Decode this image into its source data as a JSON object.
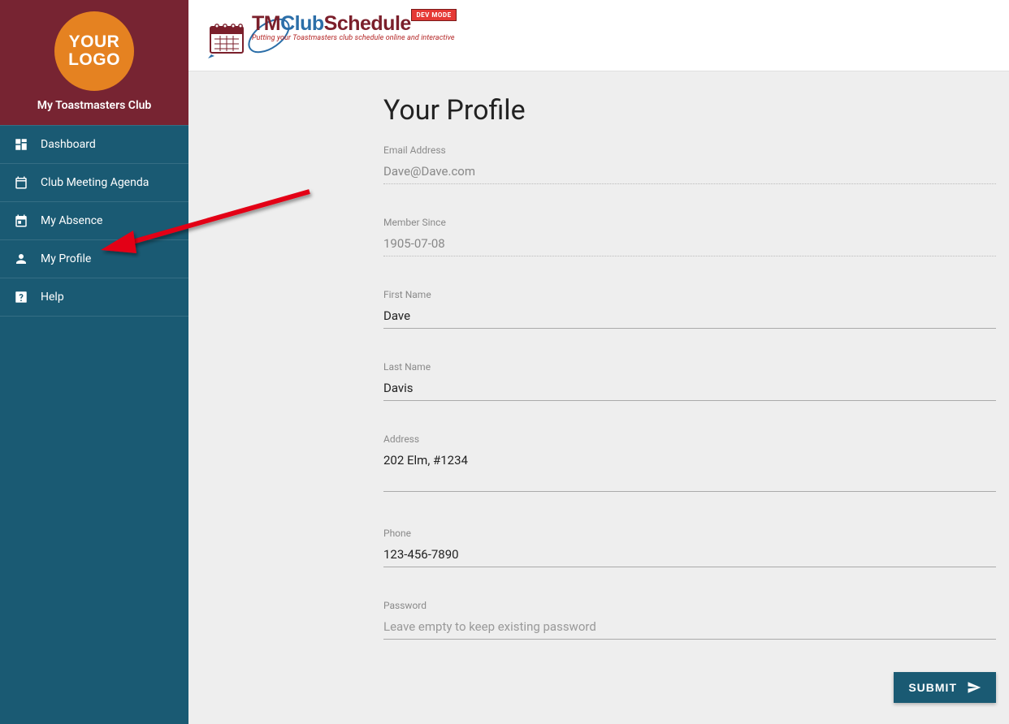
{
  "sidebar": {
    "logo_line1": "YOUR",
    "logo_line2": "LOGO",
    "club_name": "My Toastmasters Club",
    "items": [
      {
        "label": "Dashboard"
      },
      {
        "label": "Club Meeting Agenda"
      },
      {
        "label": "My Absence"
      },
      {
        "label": "My Profile"
      },
      {
        "label": "Help"
      }
    ]
  },
  "brand": {
    "tm": "TM",
    "club": "Club",
    "schedule": "Schedule",
    "tagline": "Putting your Toastmasters club schedule online and interactive",
    "dev_badge": "DEV MODE"
  },
  "page": {
    "title": "Your Profile"
  },
  "form": {
    "email": {
      "label": "Email Address",
      "value": "Dave@Dave.com"
    },
    "since": {
      "label": "Member Since",
      "value": "1905-07-08"
    },
    "first": {
      "label": "First Name",
      "value": "Dave"
    },
    "last": {
      "label": "Last Name",
      "value": "Davis"
    },
    "address": {
      "label": "Address",
      "value": "202 Elm, #1234"
    },
    "phone": {
      "label": "Phone",
      "value": "123-456-7890"
    },
    "password": {
      "label": "Password",
      "placeholder": "Leave empty to keep existing password"
    },
    "submit": "SUBMIT"
  }
}
